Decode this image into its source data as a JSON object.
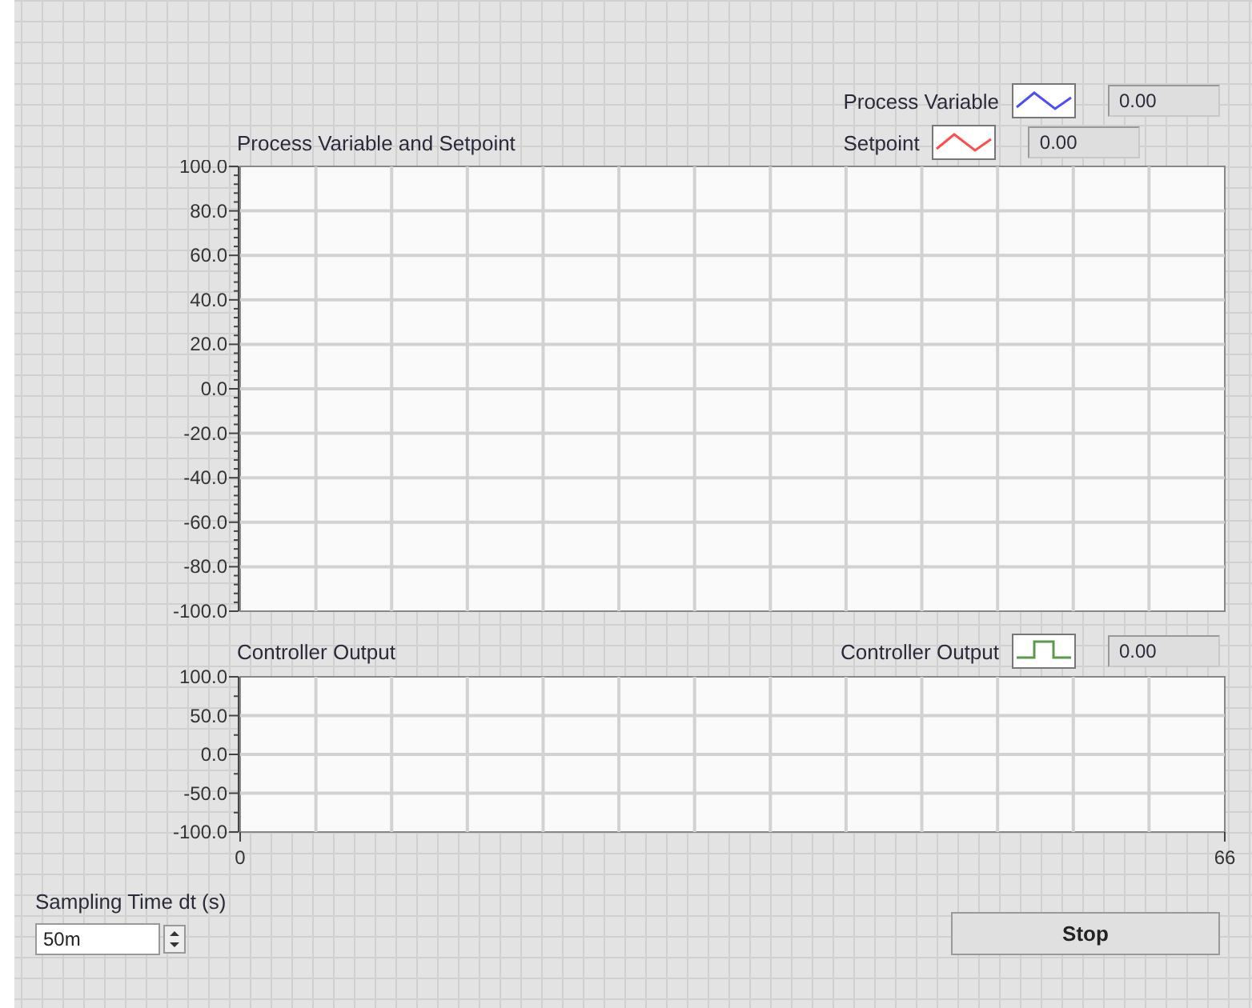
{
  "charts": [
    {
      "legend": [
        {
          "name": "Process Variable",
          "kind": "wave",
          "color": "#4d4dff",
          "value": "0.00"
        },
        {
          "name": "Setpoint",
          "kind": "wave",
          "color": "#ff4d4d",
          "value": "0.00"
        }
      ],
      "chart_data": {
        "type": "line",
        "grid": true,
        "categories": [
          null,
          null
        ],
        "title": "Process Variable and Setpoint",
        "ylim": [
          -100,
          100
        ],
        "yticks": [
          {
            "value": 100,
            "label": "100.0"
          },
          {
            "value": 80,
            "label": "80.0"
          },
          {
            "value": 60,
            "label": "60.0"
          },
          {
            "value": 40,
            "label": "40.0"
          },
          {
            "value": 20,
            "label": "20.0"
          },
          {
            "value": 0,
            "label": "0.0"
          },
          {
            "value": -20,
            "label": "-20.0"
          },
          {
            "value": -40,
            "label": "-40.0"
          },
          {
            "value": -60,
            "label": "-60.0"
          },
          {
            "value": -80,
            "label": "-80.0"
          },
          {
            "value": -100,
            "label": "-100.0"
          }
        ]
      }
    },
    {
      "legend": [
        {
          "name": "Controller Output",
          "kind": "step",
          "color": "#5a9a4a",
          "value": "0.00"
        }
      ],
      "chart_data": {
        "type": "line",
        "grid": true,
        "title": "Controller Output",
        "ylim": [
          -100,
          100
        ],
        "yticks": [
          {
            "value": 100,
            "label": "100.0"
          },
          {
            "value": 50,
            "label": "50.0"
          },
          {
            "value": 0,
            "label": "0.0"
          },
          {
            "value": -50,
            "label": "-50.0"
          },
          {
            "value": -100,
            "label": "-100.0"
          }
        ],
        "xlim": [
          0,
          66
        ],
        "xticks": [
          0,
          66
        ]
      }
    }
  ],
  "sampling_time": {
    "label": "Sampling Time dt (s)",
    "value": "50m"
  },
  "stop_button": {
    "label": "Stop"
  }
}
